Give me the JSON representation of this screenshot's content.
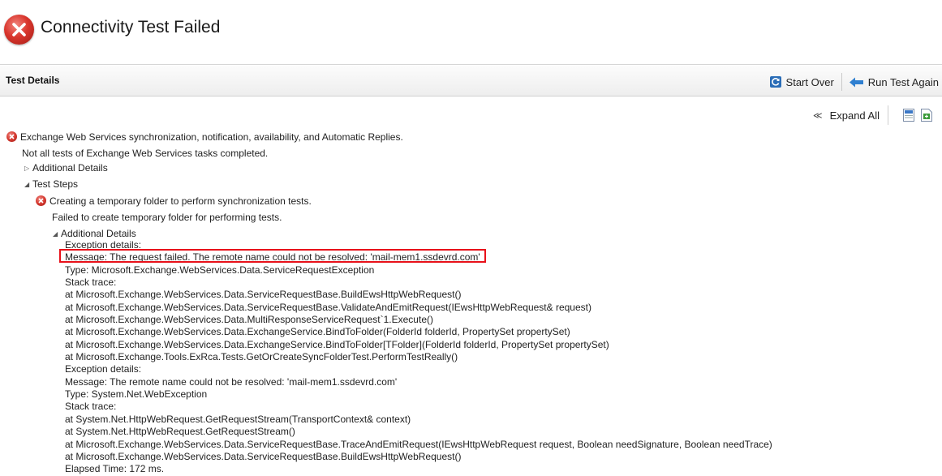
{
  "header": {
    "title": "Connectivity Test Failed",
    "status_icon": "error-x-icon",
    "status_color": "#d9362d"
  },
  "toolbar": {
    "section_title": "Test Details",
    "start_over_label": "Start Over",
    "run_again_label": "Run Test Again",
    "expand_all_label": "Expand All"
  },
  "results": {
    "main_title": "Exchange Web Services synchronization, notification, availability, and Automatic Replies.",
    "main_summary": "Not all tests of Exchange Web Services tasks completed.",
    "additional_details_label": "Additional Details",
    "test_steps_label": "Test Steps",
    "step_title": "Creating a temporary folder to perform synchronization tests.",
    "step_summary": "Failed to create temporary folder for performing tests.",
    "step_additional_details_label": "Additional Details",
    "details_lines": [
      "Exception details:",
      "Message: The request failed. The remote name could not be resolved: 'mail-mem1.ssdevrd.com'",
      "Type: Microsoft.Exchange.WebServices.Data.ServiceRequestException",
      "Stack trace:",
      "at Microsoft.Exchange.WebServices.Data.ServiceRequestBase.BuildEwsHttpWebRequest()",
      "at Microsoft.Exchange.WebServices.Data.ServiceRequestBase.ValidateAndEmitRequest(IEwsHttpWebRequest& request)",
      "at Microsoft.Exchange.WebServices.Data.MultiResponseServiceRequest`1.Execute()",
      "at Microsoft.Exchange.WebServices.Data.ExchangeService.BindToFolder(FolderId folderId, PropertySet propertySet)",
      "at Microsoft.Exchange.WebServices.Data.ExchangeService.BindToFolder[TFolder](FolderId folderId, PropertySet propertySet)",
      "at Microsoft.Exchange.Tools.ExRca.Tests.GetOrCreateSyncFolderTest.PerformTestReally()",
      "Exception details:",
      "Message: The remote name could not be resolved: 'mail-mem1.ssdevrd.com'",
      "Type: System.Net.WebException",
      "Stack trace:",
      "at System.Net.HttpWebRequest.GetRequestStream(TransportContext& context)",
      "at System.Net.HttpWebRequest.GetRequestStream()",
      "at Microsoft.Exchange.WebServices.Data.ServiceRequestBase.TraceAndEmitRequest(IEwsHttpWebRequest request, Boolean needSignature, Boolean needTrace)",
      "at Microsoft.Exchange.WebServices.Data.ServiceRequestBase.BuildEwsHttpWebRequest()",
      "Elapsed Time: 172 ms."
    ]
  }
}
